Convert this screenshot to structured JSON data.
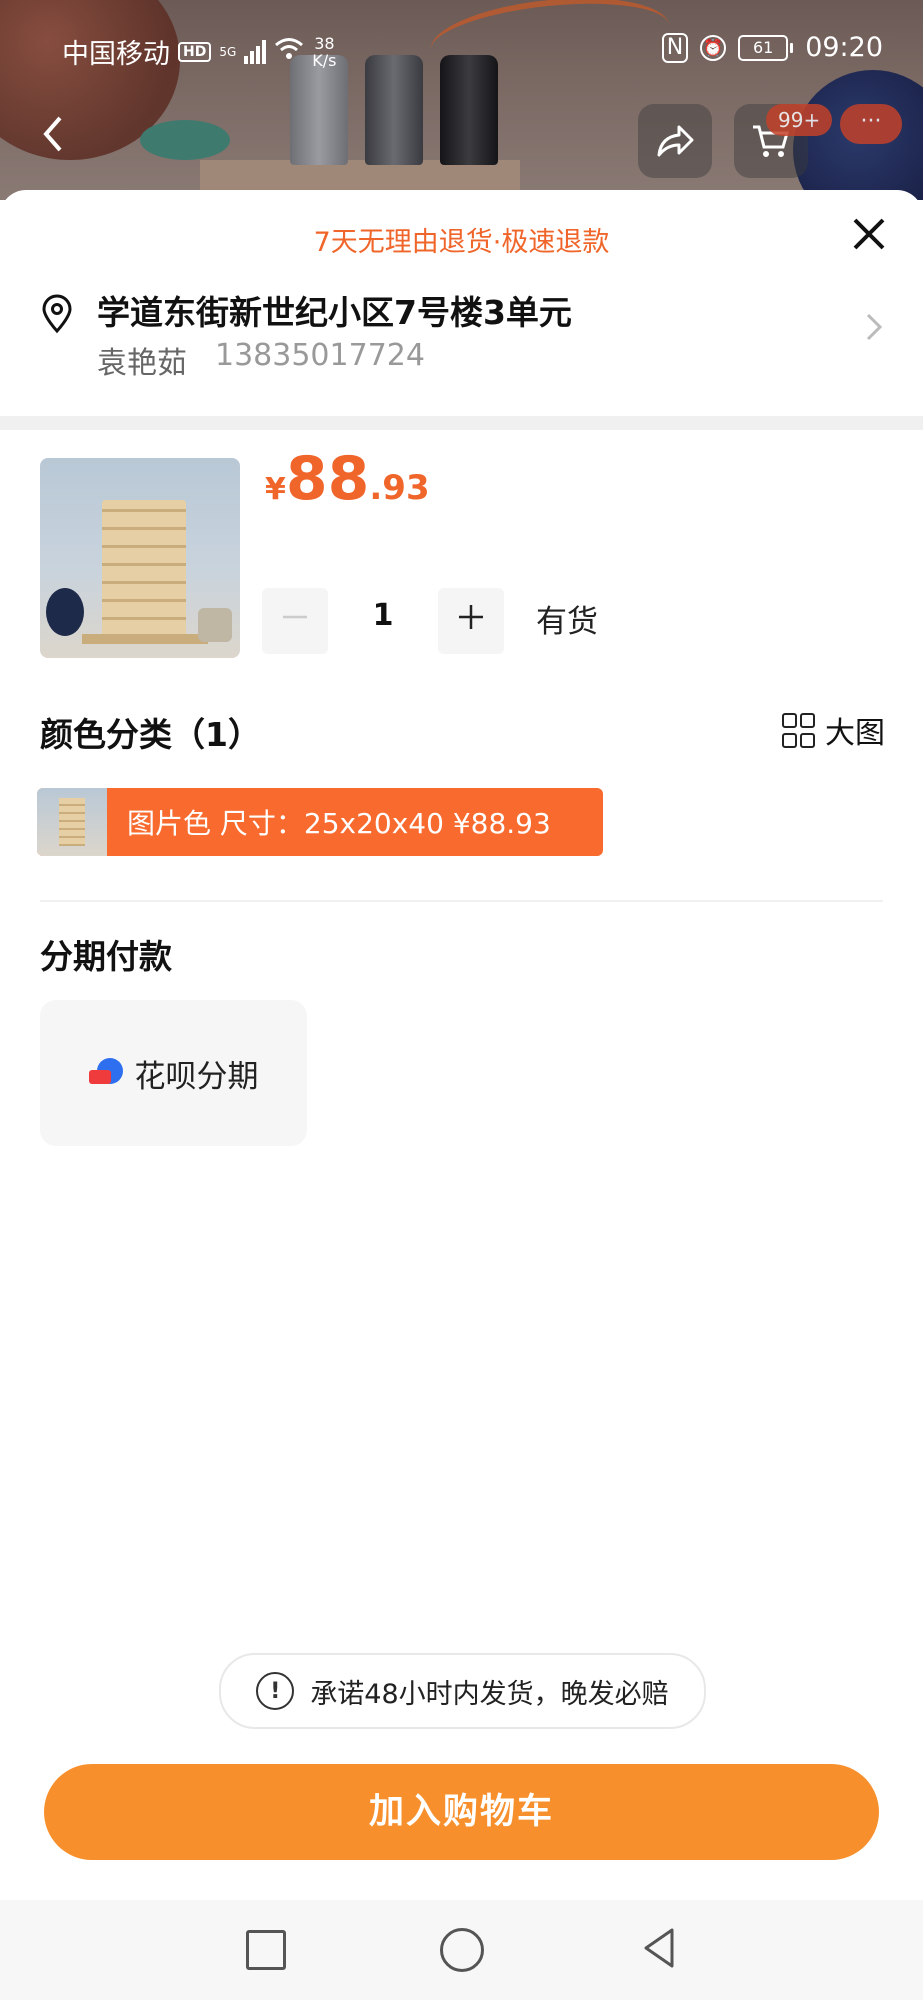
{
  "status_bar": {
    "carrier": "中国移动",
    "hd": "HD",
    "network": "5G",
    "speed_value": "38",
    "speed_unit": "K/s",
    "battery": "61",
    "time": "09:20"
  },
  "top_nav": {
    "cart_badge": "99+",
    "more_label": "···"
  },
  "sheet": {
    "promise_banner": "7天无理由退货·极速退款",
    "close_label": "✕"
  },
  "address": {
    "line": "学道东街新世纪小区7号楼3单元",
    "name": "袁艳茹",
    "phone": "13835017724"
  },
  "product": {
    "price_currency": "¥",
    "price_int": "88",
    "price_dec": ".93",
    "quantity": "1",
    "stock_status": "有货"
  },
  "color_section": {
    "title": "颜色分类（1）",
    "big_image_label": "大图",
    "options": [
      {
        "label": "图片色 尺寸：25x20x40  ¥88.93",
        "selected": true
      }
    ]
  },
  "installment": {
    "title": "分期付款",
    "option_label": "花呗分期"
  },
  "shipping_promise": "承诺48小时内发货，晚发必赔",
  "add_to_cart_label": "加入购物车",
  "colors": {
    "accent": "#f0652a",
    "button": "#f7902c",
    "chip": "#f86a2e"
  }
}
